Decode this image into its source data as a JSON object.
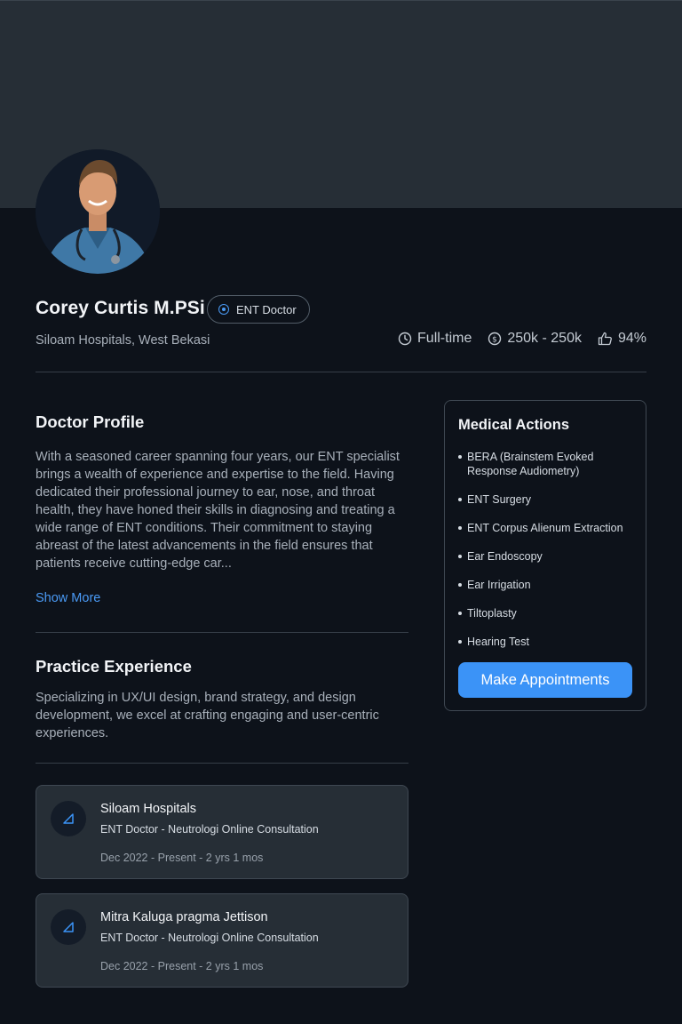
{
  "profile": {
    "name": "Corey Curtis M.PSi",
    "role_badge": "ENT Doctor",
    "hospital": "Siloam Hospitals, West Bekasi",
    "stats": {
      "employment": "Full-time",
      "fee": "250k - 250k",
      "rating": "94%"
    }
  },
  "doctor_profile": {
    "title": "Doctor Profile",
    "body": "With a seasoned career spanning four years, our ENT specialist brings a wealth of experience and expertise to the field. Having dedicated their professional journey to ear, nose, and throat health, they have honed their skills in diagnosing and treating a wide range of ENT conditions. Their commitment to staying abreast of the latest advancements in the field ensures that patients receive cutting-edge car...",
    "show_more": "Show More"
  },
  "practice": {
    "title": "Practice Experience",
    "body": "Specializing in UX/UI design, brand strategy, and design development, we excel at crafting engaging and user-centric experiences.",
    "items": [
      {
        "hospital": "Siloam Hospitals",
        "role": "ENT Doctor - Neutrologi Online Consultation",
        "date": "Dec 2022 - Present  - 2 yrs 1 mos"
      },
      {
        "hospital": "Mitra Kaluga pragma Jettison",
        "role": "ENT Doctor - Neutrologi Online Consultation",
        "date": "Dec 2022 - Present  - 2 yrs 1 mos"
      }
    ]
  },
  "medical_actions": {
    "title": "Medical Actions",
    "items": [
      "BERA (Brainstem Evoked Response Audiometry)",
      "ENT Surgery",
      "ENT Corpus Alienum Extraction",
      "Ear Endoscopy",
      "Ear Irrigation",
      "Tiltoplasty",
      "Hearing Test"
    ],
    "button": "Make Appointments"
  },
  "colors": {
    "background": "#0d121a",
    "cover": "#262e36",
    "accent": "#3b93f7",
    "card": "#262e36"
  },
  "icons": {
    "badge": "target-dot-icon",
    "employment": "clock-icon",
    "fee": "dollar-coin-icon",
    "rating": "thumbs-up-icon",
    "experience": "hospital-logo-icon"
  }
}
